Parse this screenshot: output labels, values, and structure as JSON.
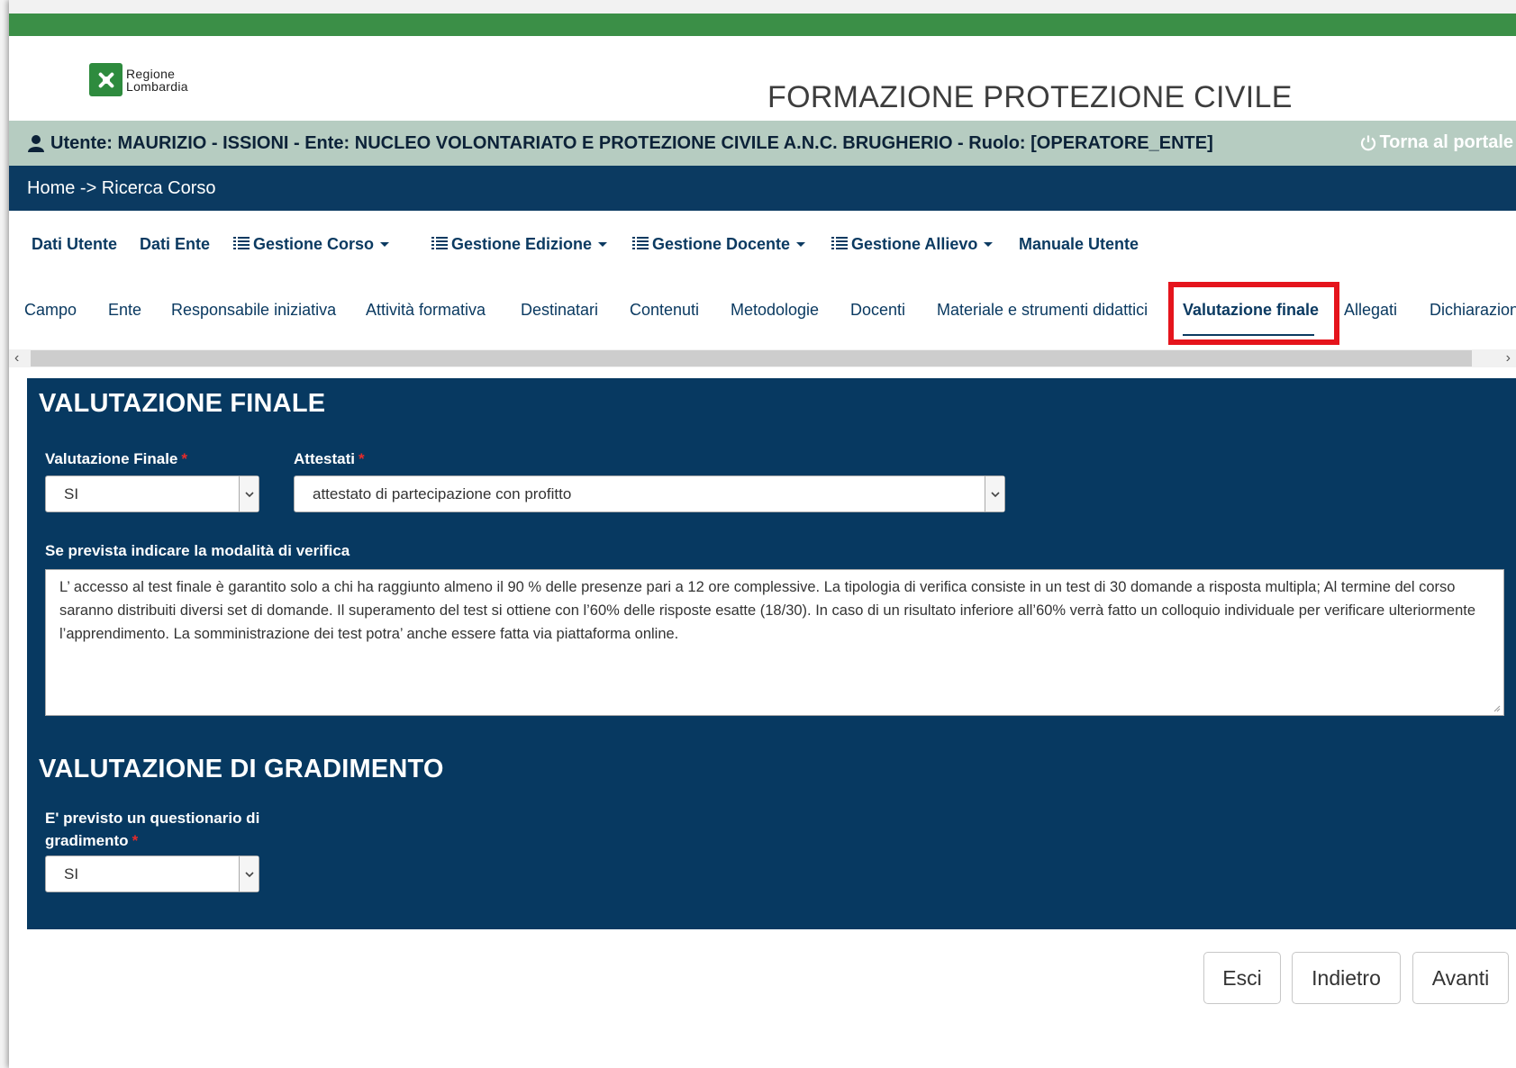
{
  "logo": {
    "line1": "Regione",
    "line2": "Lombardia",
    "icon": "regione-lombardia-logo"
  },
  "app_title": "FORMAZIONE PROTEZIONE CIVILE",
  "userbar": {
    "user_text": "Utente: MAURIZIO - ISSIONI - Ente: NUCLEO VOLONTARIATO E PROTEZIONE CIVILE A.N.C. BRUGHERIO - Ruolo: [OPERATORE_ENTE]",
    "portal_label": "Torna al portale",
    "icons": [
      "user-icon",
      "power-icon"
    ]
  },
  "breadcrumb": "Home -> Ricerca Corso",
  "menu": {
    "dati_utente": "Dati Utente",
    "dati_ente": "Dati Ente",
    "gestione_corso": "Gestione Corso",
    "gestione_edizione": "Gestione Edizione",
    "gestione_docente": "Gestione Docente",
    "gestione_allievo": "Gestione Allievo",
    "manuale_utente": "Manuale Utente"
  },
  "tabs": {
    "campo": "Campo",
    "ente": "Ente",
    "responsabile": "Responsabile iniziativa",
    "attivita": "Attività formativa",
    "destinatari": "Destinatari",
    "contenuti": "Contenuti",
    "metodologie": "Metodologie",
    "docenti": "Docenti",
    "materiale": "Materiale e strumenti didattici",
    "valutazione": "Valutazione finale",
    "allegati": "Allegati",
    "dichiarazioni": "Dichiarazion"
  },
  "active_tab": "Valutazione finale",
  "section1": {
    "title": "VALUTAZIONE FINALE",
    "valutazione_label": "Valutazione Finale",
    "valutazione_value": "SI",
    "attestati_label": "Attestati",
    "attestati_value": "attestato di partecipazione con profitto",
    "verifica_label": "Se prevista indicare la modalità di verifica",
    "verifica_text": "L’ accesso al test finale è garantito solo a chi ha raggiunto almeno il 90 % delle presenze pari a 12 ore complessive.  La tipologia di verifica consiste in un test di 30 domande a risposta multipla; Al termine del corso saranno distribuiti diversi set di domande. Il superamento del test si ottiene con l’60% delle risposte esatte (18/30). In caso di un risultato inferiore all’60% verrà fatto un colloquio individuale per verificare ulteriormente l’apprendimento. La somministrazione dei test potra’ anche essere fatta via piattaforma online."
  },
  "section2": {
    "title": "VALUTAZIONE DI GRADIMENTO",
    "questionario_label_1": "E' previsto un questionario di",
    "questionario_label_2": "gradimento",
    "questionario_value": "SI"
  },
  "required_mark": "*",
  "buttons": {
    "esci": "Esci",
    "indietro": "Indietro",
    "avanti": "Avanti"
  },
  "colors": {
    "green": "#3b8f47",
    "navy": "#0b3a61",
    "panel": "#073961",
    "userbar": "#b6ccc1",
    "highlight": "#e5141c"
  }
}
